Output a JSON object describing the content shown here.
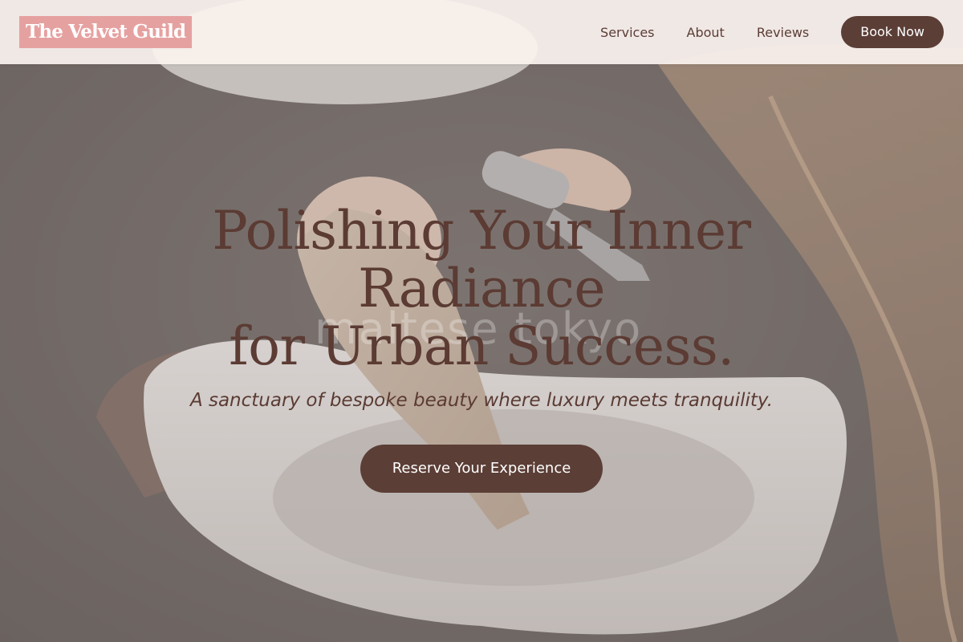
{
  "brand": {
    "logo_text": "The Velvet Guild"
  },
  "nav": {
    "links": [
      {
        "label": "Services"
      },
      {
        "label": "About"
      },
      {
        "label": "Reviews"
      }
    ],
    "book_label": "Book Now"
  },
  "hero": {
    "title_lines": [
      "Polishing Your Inner",
      "Radiance",
      "for Urban Success."
    ],
    "subtitle": "A sanctuary of bespoke beauty where luxury meets tranquility.",
    "cta_label": "Reserve Your Experience",
    "image_watermark": "maltese tokyo"
  },
  "colors": {
    "brand_pink": "#e5a1a0",
    "brand_brown": "#5b3e36",
    "header_bg": "#faf2ee",
    "text_brown": "#5b3b33"
  }
}
